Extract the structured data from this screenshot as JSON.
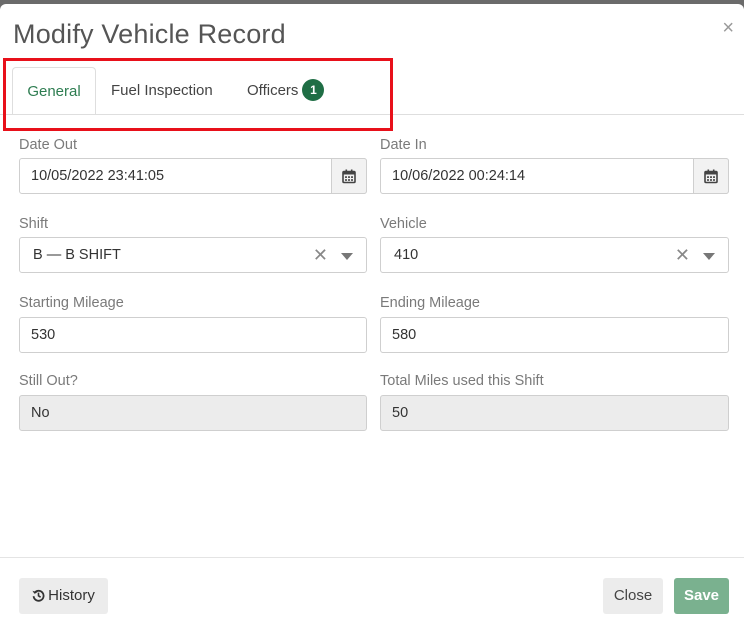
{
  "dialog": {
    "title": "Modify Vehicle Record",
    "close_glyph": "×"
  },
  "tabs": [
    {
      "label": "General",
      "active": true
    },
    {
      "label": "Fuel Inspection",
      "active": false
    },
    {
      "label": "Officers",
      "active": false,
      "badge": "1"
    }
  ],
  "form": {
    "date_out": {
      "label": "Date Out",
      "value": "10/05/2022 23:41:05",
      "icon": "calendar-icon"
    },
    "date_in": {
      "label": "Date In",
      "value": "10/06/2022 00:24:14",
      "icon": "calendar-icon"
    },
    "shift": {
      "label": "Shift",
      "value": "B — B SHIFT"
    },
    "vehicle": {
      "label": "Vehicle",
      "value": "410"
    },
    "starting_mileage": {
      "label": "Starting Mileage",
      "value": "530"
    },
    "ending_mileage": {
      "label": "Ending Mileage",
      "value": "580"
    },
    "still_out": {
      "label": "Still Out?",
      "value": "No"
    },
    "total_miles": {
      "label": "Total Miles used this Shift",
      "value": "50"
    }
  },
  "footer": {
    "history_label": "History",
    "close_label": "Close",
    "save_label": "Save"
  },
  "colors": {
    "accent": "#2e7d51",
    "badge": "#1f6e45",
    "save_button": "#7ab18f",
    "highlight": "#e8101a"
  }
}
